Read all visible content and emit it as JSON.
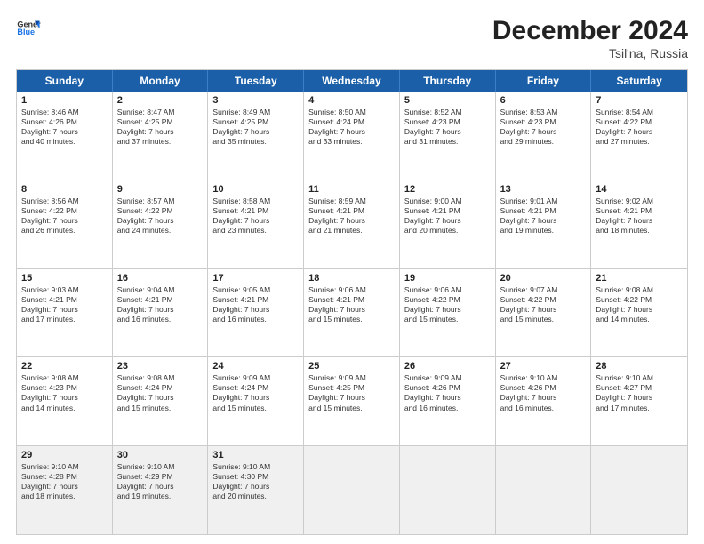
{
  "logo": {
    "line1": "General",
    "line2": "Blue"
  },
  "title": "December 2024",
  "subtitle": "Tsil'na, Russia",
  "days": [
    "Sunday",
    "Monday",
    "Tuesday",
    "Wednesday",
    "Thursday",
    "Friday",
    "Saturday"
  ],
  "weeks": [
    [
      {
        "day": 1,
        "lines": [
          "Sunrise: 8:46 AM",
          "Sunset: 4:26 PM",
          "Daylight: 7 hours",
          "and 40 minutes."
        ]
      },
      {
        "day": 2,
        "lines": [
          "Sunrise: 8:47 AM",
          "Sunset: 4:25 PM",
          "Daylight: 7 hours",
          "and 37 minutes."
        ]
      },
      {
        "day": 3,
        "lines": [
          "Sunrise: 8:49 AM",
          "Sunset: 4:25 PM",
          "Daylight: 7 hours",
          "and 35 minutes."
        ]
      },
      {
        "day": 4,
        "lines": [
          "Sunrise: 8:50 AM",
          "Sunset: 4:24 PM",
          "Daylight: 7 hours",
          "and 33 minutes."
        ]
      },
      {
        "day": 5,
        "lines": [
          "Sunrise: 8:52 AM",
          "Sunset: 4:23 PM",
          "Daylight: 7 hours",
          "and 31 minutes."
        ]
      },
      {
        "day": 6,
        "lines": [
          "Sunrise: 8:53 AM",
          "Sunset: 4:23 PM",
          "Daylight: 7 hours",
          "and 29 minutes."
        ]
      },
      {
        "day": 7,
        "lines": [
          "Sunrise: 8:54 AM",
          "Sunset: 4:22 PM",
          "Daylight: 7 hours",
          "and 27 minutes."
        ]
      }
    ],
    [
      {
        "day": 8,
        "lines": [
          "Sunrise: 8:56 AM",
          "Sunset: 4:22 PM",
          "Daylight: 7 hours",
          "and 26 minutes."
        ]
      },
      {
        "day": 9,
        "lines": [
          "Sunrise: 8:57 AM",
          "Sunset: 4:22 PM",
          "Daylight: 7 hours",
          "and 24 minutes."
        ]
      },
      {
        "day": 10,
        "lines": [
          "Sunrise: 8:58 AM",
          "Sunset: 4:21 PM",
          "Daylight: 7 hours",
          "and 23 minutes."
        ]
      },
      {
        "day": 11,
        "lines": [
          "Sunrise: 8:59 AM",
          "Sunset: 4:21 PM",
          "Daylight: 7 hours",
          "and 21 minutes."
        ]
      },
      {
        "day": 12,
        "lines": [
          "Sunrise: 9:00 AM",
          "Sunset: 4:21 PM",
          "Daylight: 7 hours",
          "and 20 minutes."
        ]
      },
      {
        "day": 13,
        "lines": [
          "Sunrise: 9:01 AM",
          "Sunset: 4:21 PM",
          "Daylight: 7 hours",
          "and 19 minutes."
        ]
      },
      {
        "day": 14,
        "lines": [
          "Sunrise: 9:02 AM",
          "Sunset: 4:21 PM",
          "Daylight: 7 hours",
          "and 18 minutes."
        ]
      }
    ],
    [
      {
        "day": 15,
        "lines": [
          "Sunrise: 9:03 AM",
          "Sunset: 4:21 PM",
          "Daylight: 7 hours",
          "and 17 minutes."
        ]
      },
      {
        "day": 16,
        "lines": [
          "Sunrise: 9:04 AM",
          "Sunset: 4:21 PM",
          "Daylight: 7 hours",
          "and 16 minutes."
        ]
      },
      {
        "day": 17,
        "lines": [
          "Sunrise: 9:05 AM",
          "Sunset: 4:21 PM",
          "Daylight: 7 hours",
          "and 16 minutes."
        ]
      },
      {
        "day": 18,
        "lines": [
          "Sunrise: 9:06 AM",
          "Sunset: 4:21 PM",
          "Daylight: 7 hours",
          "and 15 minutes."
        ]
      },
      {
        "day": 19,
        "lines": [
          "Sunrise: 9:06 AM",
          "Sunset: 4:22 PM",
          "Daylight: 7 hours",
          "and 15 minutes."
        ]
      },
      {
        "day": 20,
        "lines": [
          "Sunrise: 9:07 AM",
          "Sunset: 4:22 PM",
          "Daylight: 7 hours",
          "and 15 minutes."
        ]
      },
      {
        "day": 21,
        "lines": [
          "Sunrise: 9:08 AM",
          "Sunset: 4:22 PM",
          "Daylight: 7 hours",
          "and 14 minutes."
        ]
      }
    ],
    [
      {
        "day": 22,
        "lines": [
          "Sunrise: 9:08 AM",
          "Sunset: 4:23 PM",
          "Daylight: 7 hours",
          "and 14 minutes."
        ]
      },
      {
        "day": 23,
        "lines": [
          "Sunrise: 9:08 AM",
          "Sunset: 4:24 PM",
          "Daylight: 7 hours",
          "and 15 minutes."
        ]
      },
      {
        "day": 24,
        "lines": [
          "Sunrise: 9:09 AM",
          "Sunset: 4:24 PM",
          "Daylight: 7 hours",
          "and 15 minutes."
        ]
      },
      {
        "day": 25,
        "lines": [
          "Sunrise: 9:09 AM",
          "Sunset: 4:25 PM",
          "Daylight: 7 hours",
          "and 15 minutes."
        ]
      },
      {
        "day": 26,
        "lines": [
          "Sunrise: 9:09 AM",
          "Sunset: 4:26 PM",
          "Daylight: 7 hours",
          "and 16 minutes."
        ]
      },
      {
        "day": 27,
        "lines": [
          "Sunrise: 9:10 AM",
          "Sunset: 4:26 PM",
          "Daylight: 7 hours",
          "and 16 minutes."
        ]
      },
      {
        "day": 28,
        "lines": [
          "Sunrise: 9:10 AM",
          "Sunset: 4:27 PM",
          "Daylight: 7 hours",
          "and 17 minutes."
        ]
      }
    ],
    [
      {
        "day": 29,
        "lines": [
          "Sunrise: 9:10 AM",
          "Sunset: 4:28 PM",
          "Daylight: 7 hours",
          "and 18 minutes."
        ]
      },
      {
        "day": 30,
        "lines": [
          "Sunrise: 9:10 AM",
          "Sunset: 4:29 PM",
          "Daylight: 7 hours",
          "and 19 minutes."
        ]
      },
      {
        "day": 31,
        "lines": [
          "Sunrise: 9:10 AM",
          "Sunset: 4:30 PM",
          "Daylight: 7 hours",
          "and 20 minutes."
        ]
      },
      null,
      null,
      null,
      null
    ]
  ]
}
